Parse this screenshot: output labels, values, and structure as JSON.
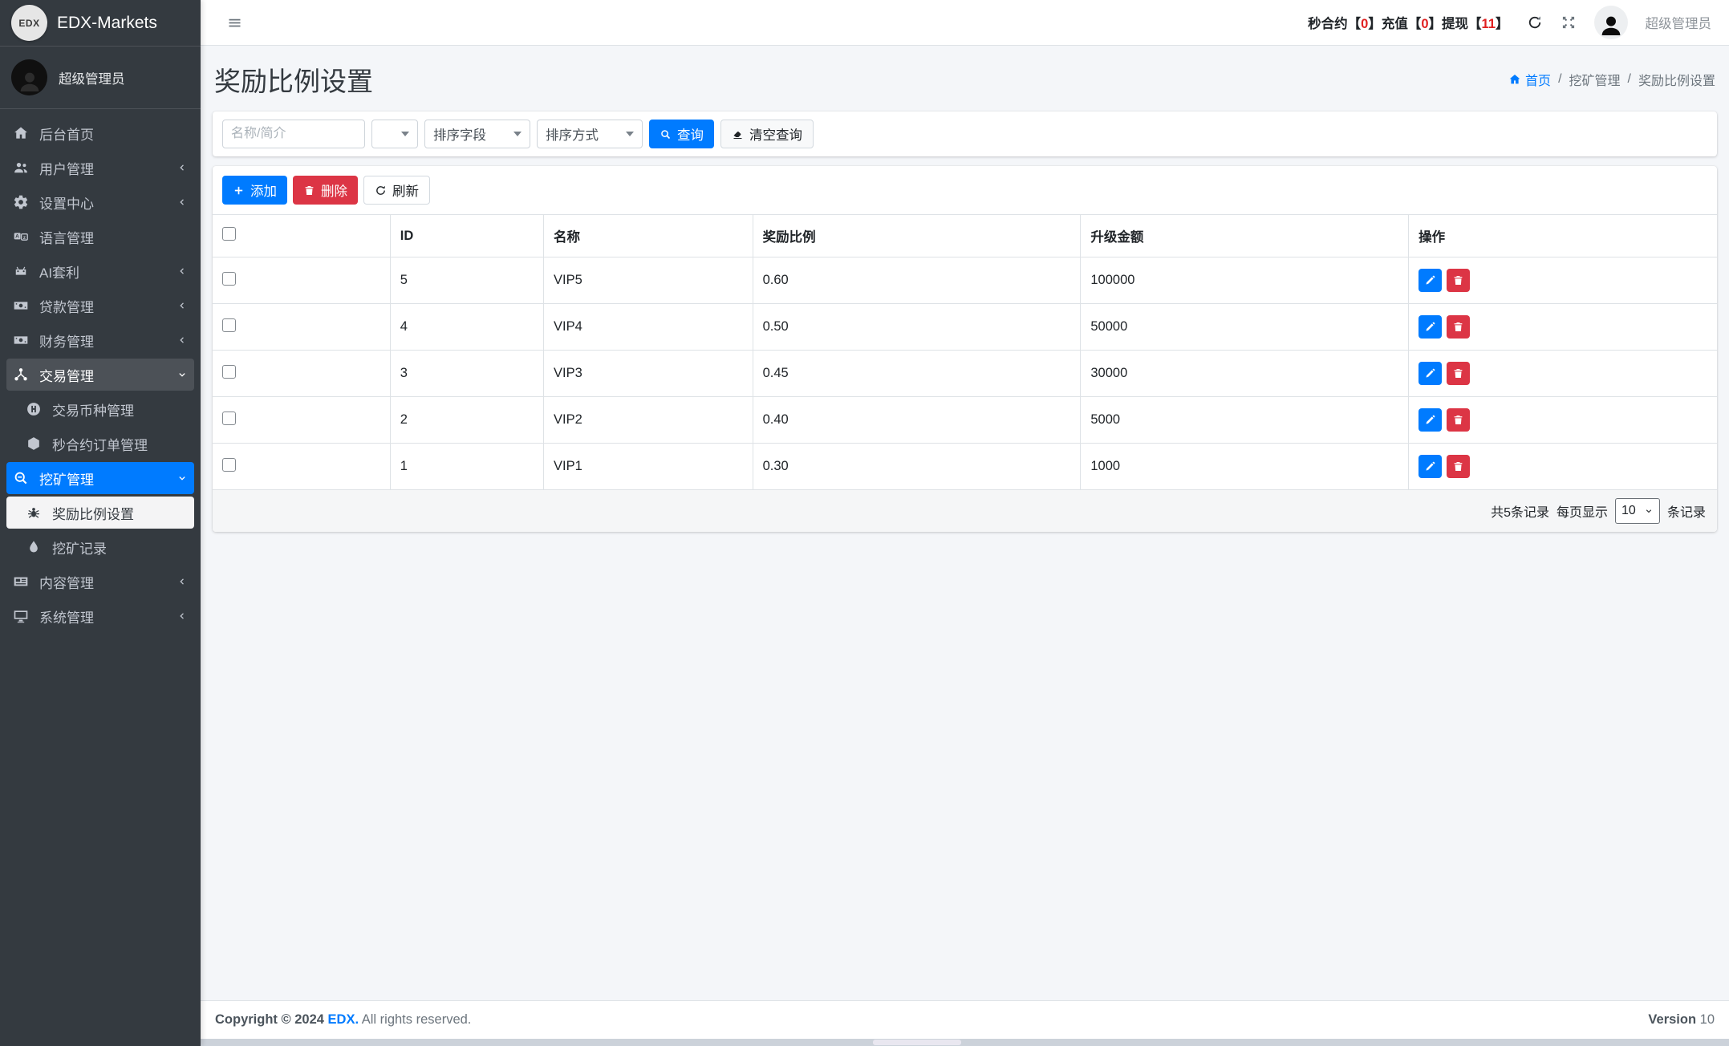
{
  "brand": {
    "logo": "EDX",
    "name": "EDX-Markets"
  },
  "sidebar": {
    "user_name": "超级管理员",
    "items": [
      {
        "label": "后台首页"
      },
      {
        "label": "用户管理"
      },
      {
        "label": "设置中心"
      },
      {
        "label": "语言管理"
      },
      {
        "label": "AI套利"
      },
      {
        "label": "贷款管理"
      },
      {
        "label": "财务管理"
      },
      {
        "label": "交易管理"
      },
      {
        "label": "交易币种管理"
      },
      {
        "label": "秒合约订单管理"
      },
      {
        "label": "挖矿管理"
      },
      {
        "label": "奖励比例设置"
      },
      {
        "label": "挖矿记录"
      },
      {
        "label": "内容管理"
      },
      {
        "label": "系统管理"
      }
    ]
  },
  "topbar": {
    "notice": {
      "p1": "秒合约【",
      "n1": "0",
      "p2": "】充值【",
      "n2": "0",
      "p3": "】提现【",
      "n3": "11",
      "p4": "】"
    },
    "user_name": "超级管理员"
  },
  "page": {
    "title": "奖励比例设置",
    "breadcrumb": {
      "home": "首页",
      "sep": "/",
      "level1": "挖矿管理",
      "current": "奖励比例设置"
    }
  },
  "filters": {
    "keyword_placeholder": "名称/简介",
    "sort_field_label": "排序字段",
    "sort_order_label": "排序方式",
    "search_button": "查询",
    "clear_button": "清空查询"
  },
  "toolbar": {
    "add": "添加",
    "delete": "删除",
    "refresh": "刷新"
  },
  "table": {
    "headers": {
      "id": "ID",
      "name": "名称",
      "ratio": "奖励比例",
      "amount": "升级金额",
      "actions": "操作"
    },
    "rows": [
      {
        "id": "5",
        "name": "VIP5",
        "ratio": "0.60",
        "amount": "100000"
      },
      {
        "id": "4",
        "name": "VIP4",
        "ratio": "0.50",
        "amount": "50000"
      },
      {
        "id": "3",
        "name": "VIP3",
        "ratio": "0.45",
        "amount": "30000"
      },
      {
        "id": "2",
        "name": "VIP2",
        "ratio": "0.40",
        "amount": "5000"
      },
      {
        "id": "1",
        "name": "VIP1",
        "ratio": "0.30",
        "amount": "1000"
      }
    ]
  },
  "pagination": {
    "total": "共5条记录",
    "per_page_prefix": "每页显示",
    "page_size": "10",
    "per_page_suffix": "条记录"
  },
  "footer": {
    "copyright": "Copyright © 2024",
    "brand": "EDX.",
    "rights": "All rights reserved.",
    "version_label": "Version",
    "version_value": "10"
  },
  "colors": {
    "primary": "#007bff",
    "danger": "#dc3545",
    "sidebar_bg": "#343a40",
    "body_bg": "#f4f6f9"
  }
}
